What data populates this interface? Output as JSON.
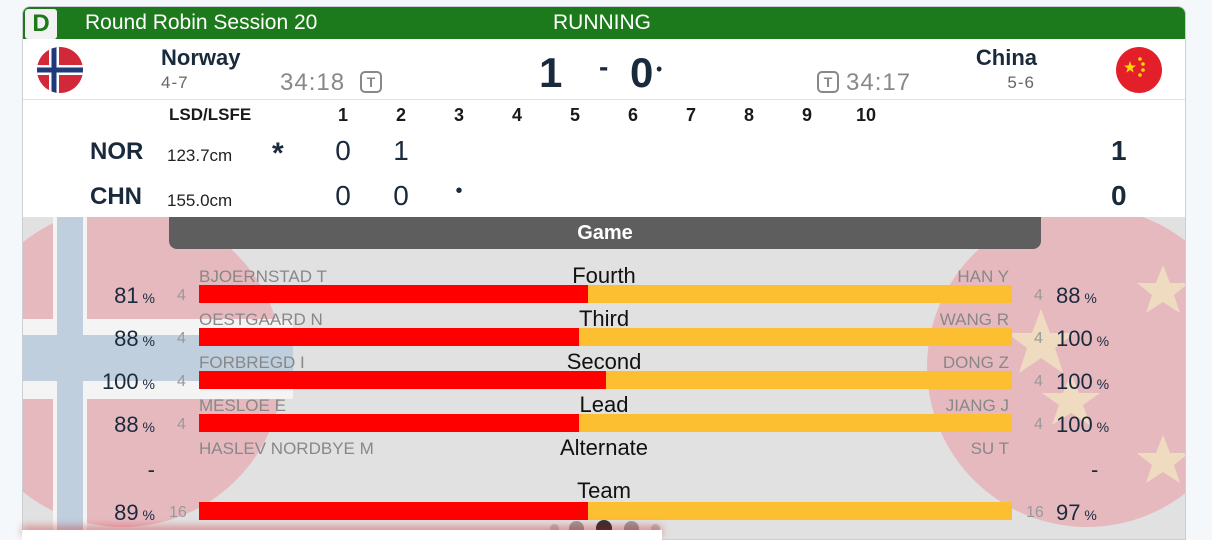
{
  "header": {
    "badge": "D",
    "session": "Round Robin Session 20",
    "status": "RUNNING"
  },
  "team_left": {
    "name": "Norway",
    "record": "4-7",
    "clock": "34:18",
    "score": "1",
    "abbr": "NOR",
    "lsd": "123.7cm",
    "total": "1",
    "ends": [
      "0",
      "1"
    ],
    "hammer_mark": "*"
  },
  "team_right": {
    "name": "China",
    "record": "5-6",
    "clock": "34:17",
    "score": "0",
    "abbr": "CHN",
    "lsd": "155.0cm",
    "total": "0",
    "ends": [
      "0",
      "0"
    ],
    "hammer_mark": "•"
  },
  "score_dash": "-",
  "hammer_dot": "•",
  "timeout_label": "T",
  "linescore": {
    "label": "LSD/LSFE",
    "ends": [
      "1",
      "2",
      "3",
      "4",
      "5",
      "6",
      "7",
      "8",
      "9",
      "10"
    ]
  },
  "stats": {
    "title": "Game",
    "rows": [
      {
        "position": "Fourth",
        "left_name": "BJOERNSTAD T",
        "left_pct": "81",
        "left_shots": "4",
        "right_name": "HAN Y",
        "right_pct": "88",
        "right_shots": "4",
        "left_share": 0.479
      },
      {
        "position": "Third",
        "left_name": "OESTGAARD N",
        "left_pct": "88",
        "left_shots": "4",
        "right_name": "WANG R",
        "right_pct": "100",
        "right_shots": "4",
        "left_share": 0.468
      },
      {
        "position": "Second",
        "left_name": "FORBREGD I",
        "left_pct": "100",
        "left_shots": "4",
        "right_name": "DONG Z",
        "right_pct": "100",
        "right_shots": "4",
        "left_share": 0.5
      },
      {
        "position": "Lead",
        "left_name": "MESLOE E",
        "left_pct": "88",
        "left_shots": "4",
        "right_name": "JIANG J",
        "right_pct": "100",
        "right_shots": "4",
        "left_share": 0.468
      },
      {
        "position": "Alternate",
        "left_name": "HASLEV NORDBYE M",
        "left_pct": "-",
        "left_shots": "",
        "right_name": "SU T",
        "right_pct": "-",
        "right_shots": "",
        "left_share": null
      },
      {
        "position": "Team",
        "left_name": "",
        "left_pct": "89",
        "left_shots": "16",
        "right_name": "",
        "right_pct": "97",
        "right_shots": "16",
        "left_share": 0.479
      }
    ],
    "pct_unit": "%"
  },
  "colors": {
    "header_green": "#1d7a1c",
    "bar_left": "#ff0000",
    "bar_right": "#fcbf32",
    "game_header": "#5e5e5e"
  },
  "icons": {
    "left_flag": "norway-flag-icon",
    "right_flag": "china-flag-icon",
    "timeout": "timeout-icon"
  },
  "pager": {
    "pages": 5,
    "active": 3
  }
}
